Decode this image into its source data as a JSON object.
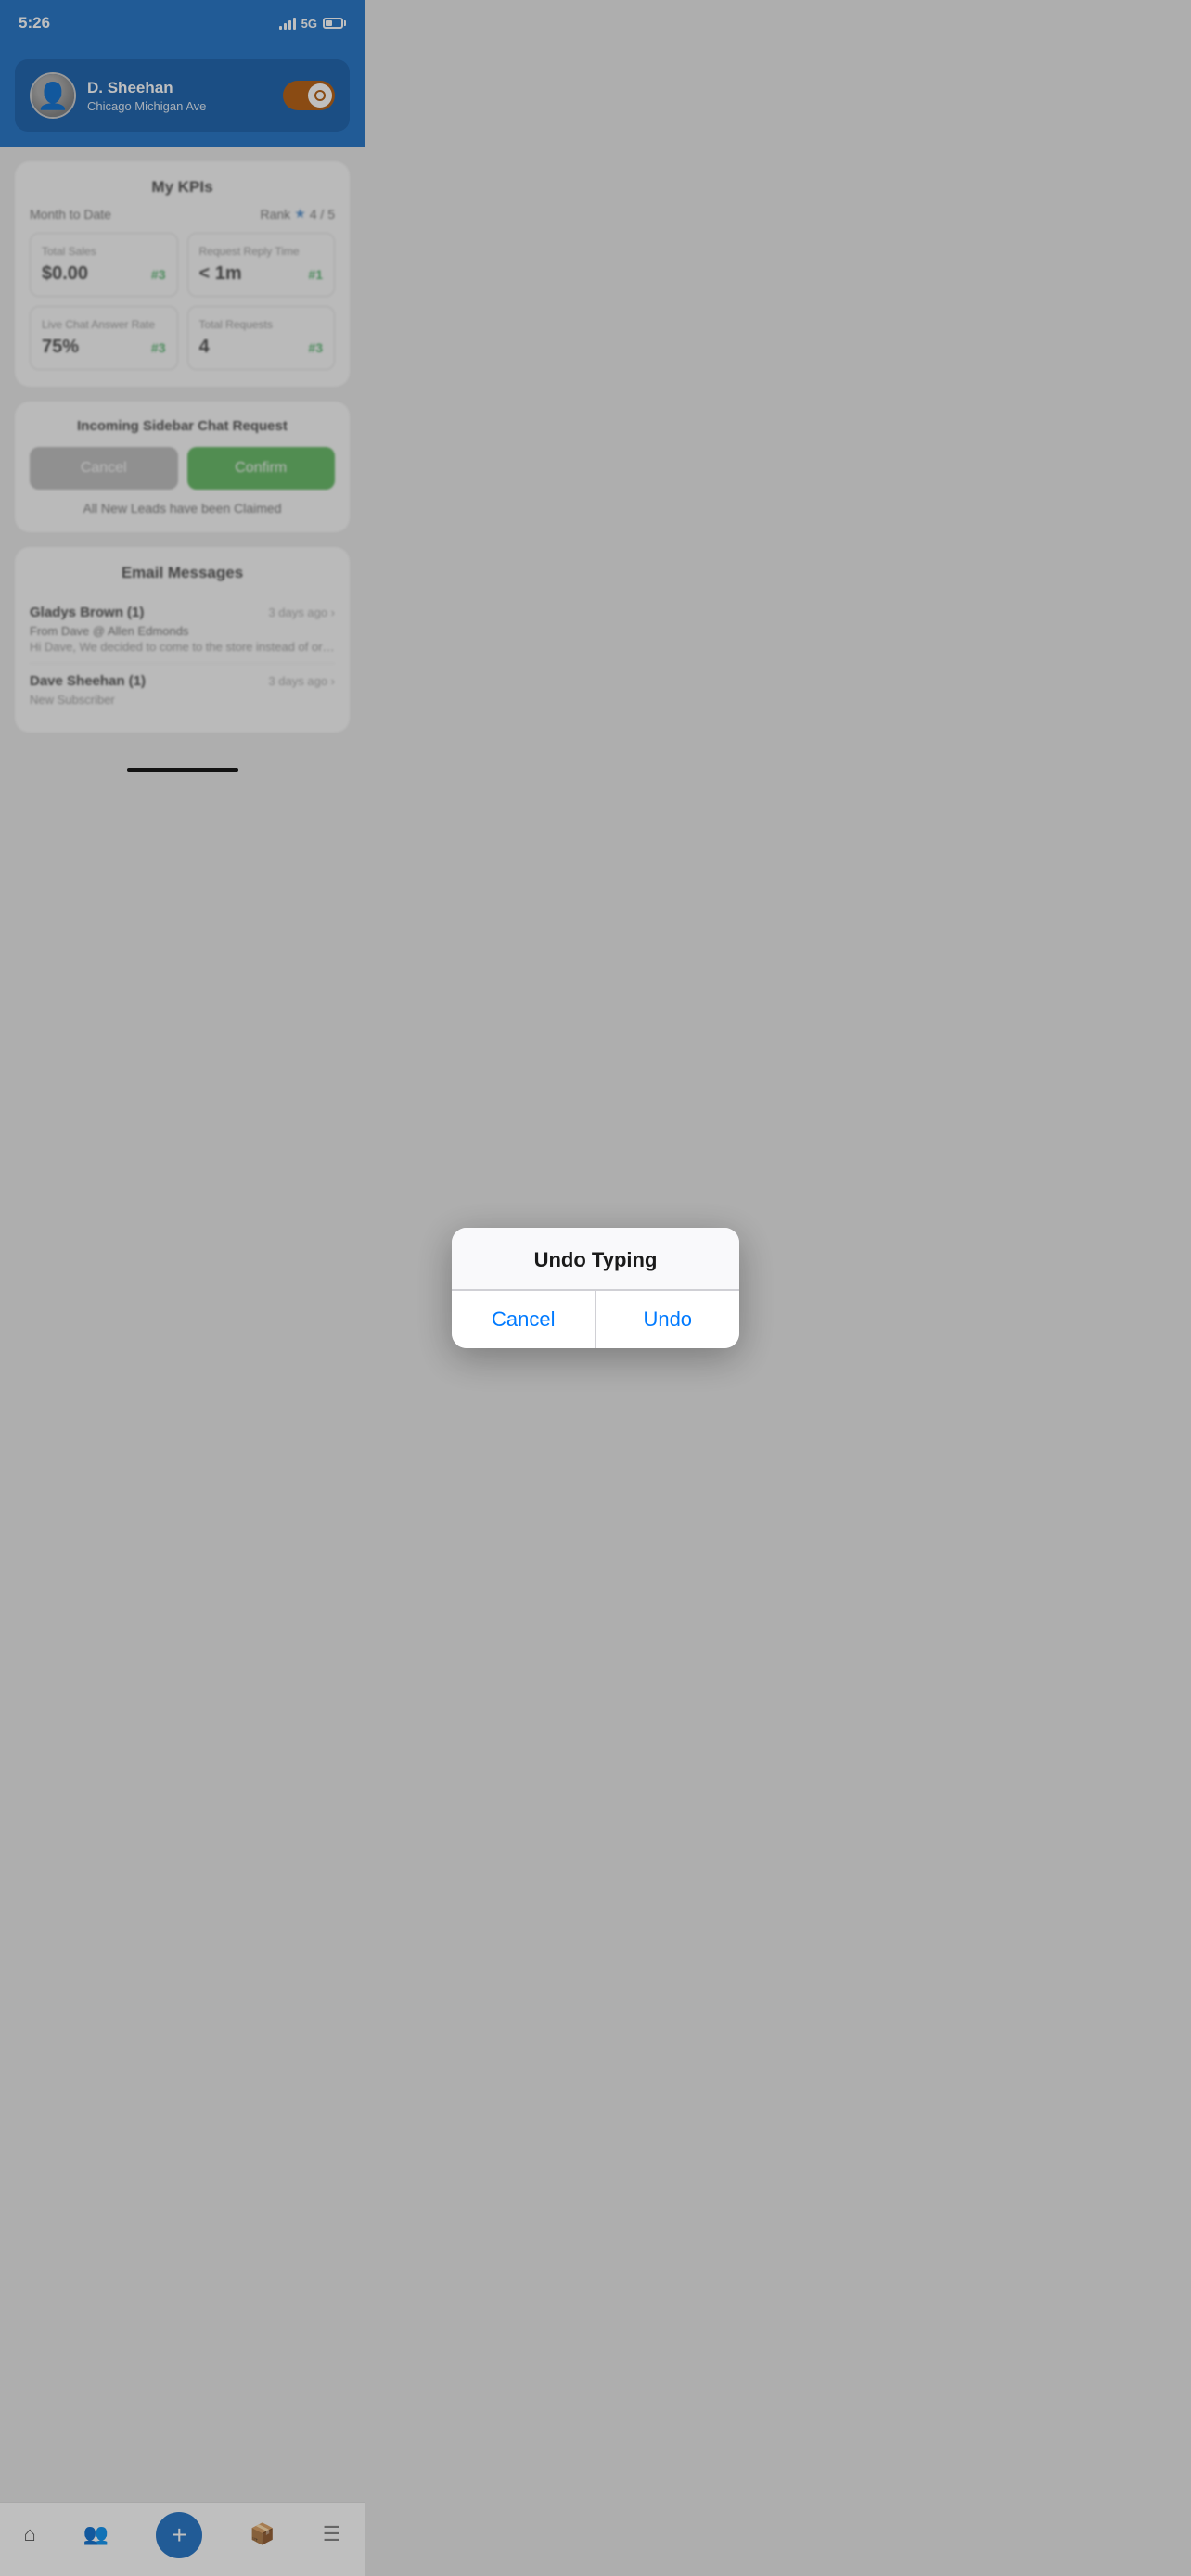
{
  "statusBar": {
    "time": "5:26",
    "networkType": "5G"
  },
  "header": {
    "userName": "D. Sheehan",
    "location": "Chicago Michigan Ave"
  },
  "kpis": {
    "title": "My KPIs",
    "period": "Month to Date",
    "rankLabel": "Rank",
    "rankValue": "4 / 5",
    "totalSales": {
      "label": "Total Sales",
      "value": "$0.00",
      "rank": "#3"
    },
    "requestReplyTime": {
      "label": "Request Reply Time",
      "value": "< 1m",
      "rank": "#1"
    },
    "liveChatAnswerRate": {
      "label": "Live Chat Answer Rate",
      "value": "75%",
      "rank": "#3"
    },
    "totalRequests": {
      "label": "Total Requests",
      "value": "4",
      "rank": "#3"
    }
  },
  "incomingSection": {
    "title": "Incoming Sidebar Chat Request",
    "cancelLabel": "Cancel",
    "confirmLabel": "Confirm",
    "allClaimedText": "All New Leads have been Claimed"
  },
  "emailMessages": {
    "title": "Email Messages",
    "items": [
      {
        "sender": "Gladys Brown (1)",
        "time": "3 days ago",
        "from": "From Dave @ Allen Edmonds",
        "preview": "Hi Dave,  We decided to come to the store instead of ordering. Thank y..."
      },
      {
        "sender": "Dave Sheehan (1)",
        "time": "3 days ago",
        "from": "New Subscriber",
        "preview": ""
      }
    ]
  },
  "modal": {
    "title": "Undo Typing",
    "cancelLabel": "Cancel",
    "undoLabel": "Undo"
  },
  "bottomNav": {
    "items": [
      {
        "label": "",
        "icon": "home"
      },
      {
        "label": "",
        "icon": "people"
      },
      {
        "label": "",
        "icon": "plus"
      },
      {
        "label": "",
        "icon": "inbox"
      },
      {
        "label": "",
        "icon": "menu"
      }
    ]
  }
}
